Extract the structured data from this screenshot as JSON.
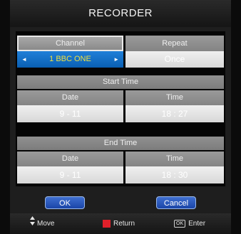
{
  "title": "RECORDER",
  "channel": {
    "header": "Channel",
    "value": "1 BBC ONE",
    "left_arrow": "◄",
    "right_arrow": "►"
  },
  "repeat": {
    "header": "Repeat",
    "value": "Once"
  },
  "start_time": {
    "section_title": "Start Time",
    "date_label": "Date",
    "date_value": "9 - 11",
    "time_label": "Time",
    "time_value": "18 : 27"
  },
  "end_time": {
    "section_title": "End Time",
    "date_label": "Date",
    "date_value": "9 - 11",
    "time_label": "Time",
    "time_value": "18 : 30"
  },
  "buttons": {
    "ok": "OK",
    "cancel": "Cancel"
  },
  "footer": {
    "move": "Move",
    "return": "Return",
    "enter_key": "OK",
    "enter": "Enter"
  },
  "colors": {
    "selected": "#0a5fb3",
    "selected_text": "#f0e040",
    "return_key": "#e0202a"
  }
}
